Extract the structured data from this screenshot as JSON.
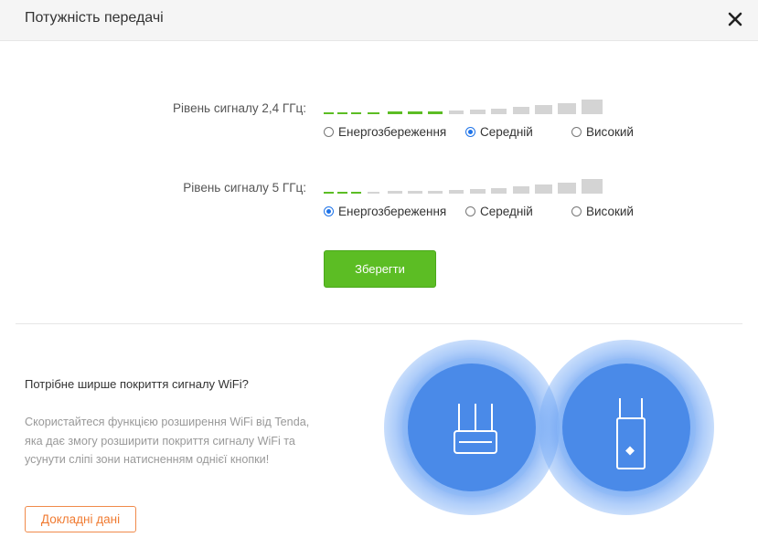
{
  "header": {
    "title": "Потужність передачі",
    "close_icon": "close-icon"
  },
  "signal_24": {
    "label": "Рівень сигналу 2,4 ГГц:",
    "level_bars_active": 7,
    "level_bars_total": 14,
    "options": [
      "Енергозбереження",
      "Середній",
      "Високий"
    ],
    "selected": "Середній"
  },
  "signal_5": {
    "label": "Рівень сигналу 5 ГГц:",
    "level_bars_active": 3,
    "level_bars_total": 14,
    "options": [
      "Енергозбереження",
      "Середній",
      "Високий"
    ],
    "selected": "Енергозбереження"
  },
  "save_button": {
    "label": "Зберегти"
  },
  "promo": {
    "title": "Потрібне ширше покриття сигналу WiFi?",
    "body": "Скористайтеся функцією розширення WiFi від Tenda, яка дає змогу розширити покриття сигналу WiFi та усунути сліпі зони натисненням однієї кнопки!",
    "details_button": "Докладні дані",
    "icons": [
      "router-icon",
      "wifi-extender-icon"
    ]
  },
  "colors": {
    "accent_green": "#5cbd24",
    "bar_active": "#5cbd24",
    "bar_inactive": "#d4d4d4",
    "radio_selected": "#1e73e8",
    "details_orange": "#f07a30",
    "glow_blue": "#3a7ce6"
  }
}
